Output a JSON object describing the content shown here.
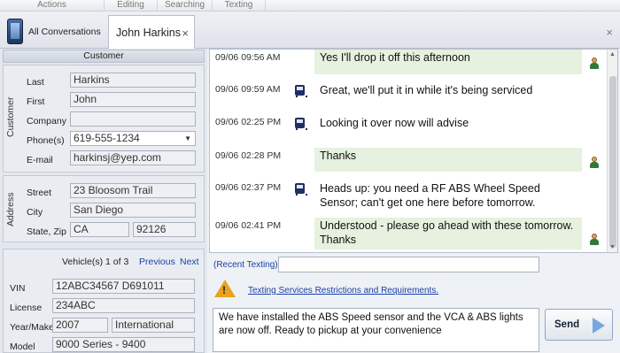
{
  "ribbon": {
    "groups": [
      "Actions",
      "Editing",
      "Searching",
      "Texting"
    ]
  },
  "tabs": {
    "all_conversations": "All Conversations",
    "active": "John Harkins",
    "close_glyph": "×"
  },
  "customer": {
    "section_title": "Customer",
    "vertical_label": "Customer",
    "fields": {
      "last_label": "Last",
      "last": "Harkins",
      "first_label": "First",
      "first": "John",
      "company_label": "Company",
      "company": "",
      "phone_label": "Phone(s)",
      "phone": "619-555-1234",
      "email_label": "E-mail",
      "email": "harkinsj@yep.com"
    }
  },
  "address": {
    "vertical_label": "Address",
    "street_label": "Street",
    "street": "23 Bloosom Trail",
    "city_label": "City",
    "city": "San Diego",
    "state_zip_label": "State, Zip",
    "state": "CA",
    "zip": "92126"
  },
  "vehicle": {
    "header": "Vehicle(s) 1 of 3",
    "previous": "Previous",
    "next": "Next",
    "vin_label": "VIN",
    "vin": "12ABC34567 D691011",
    "license_label": "License",
    "license": "234ABC",
    "year_make_label": "Year/Make",
    "year": "2007",
    "make": "International",
    "model_label": "Model",
    "model": "9000 Series - 9400"
  },
  "conversation": {
    "messages": [
      {
        "time": "09/06 09:56 AM",
        "text": "Yes I'll drop it off this afternoon",
        "direction": "in"
      },
      {
        "time": "09/06 09:59 AM",
        "text": "Great, we'll put it in while it's being serviced",
        "direction": "out"
      },
      {
        "time": "09/06 02:25 PM",
        "text": "Looking it over now will advise",
        "direction": "out"
      },
      {
        "time": "09/06 02:28 PM",
        "text": "Thanks",
        "direction": "in"
      },
      {
        "time": "09/06 02:37 PM",
        "text": "Heads up: you need a RF ABS Wheel Speed Sensor; can't get one here before tomorrow.",
        "direction": "out"
      },
      {
        "time": "09/06 02:41 PM",
        "text": "Understood - please go ahead with these tomorrow. Thanks",
        "direction": "in"
      }
    ]
  },
  "compose": {
    "recent_texting_label": "(Recent Texting)",
    "recent_texting_value": "",
    "restrictions_link": "Texting Services Restrictions and Requirements.",
    "message": "We have installed the ABS Speed sensor and the VCA & ABS lights are now off. Ready to pickup at your convenience",
    "send_label": "Send"
  },
  "colors": {
    "incoming_bubble": "#e6f1df",
    "link": "#1a3fa8",
    "warning": "#e8a21c"
  }
}
